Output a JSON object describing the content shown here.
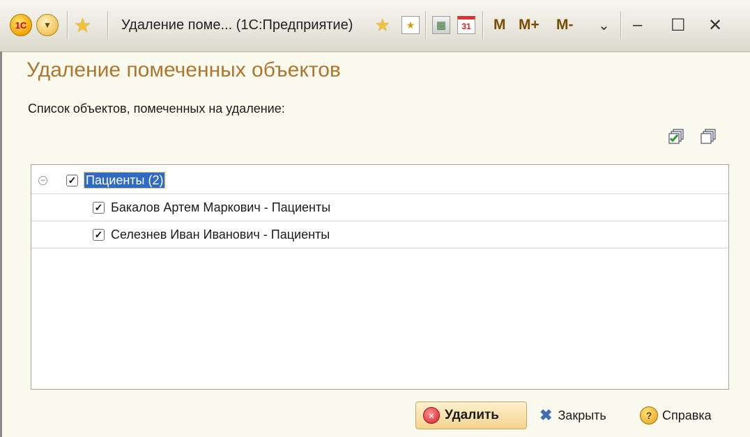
{
  "window": {
    "logo_text": "1C",
    "dropdown_glyph": "▼",
    "title": "Удаление поме...  (1С:Предприятие)",
    "memory_buttons": [
      "M",
      "M+",
      "M-"
    ],
    "overflow_glyph": "⌄",
    "minimize_glyph": "–",
    "maximize_glyph": "☐",
    "close_glyph": "✕",
    "calendar_day": "31"
  },
  "form": {
    "heading": "Удаление помеченных объектов",
    "list_label": "Список объектов, помеченных на удаление:"
  },
  "tree": {
    "group": {
      "label": "Пациенты (2)",
      "checked": true,
      "expanded": true
    },
    "items": [
      {
        "label": "Бакалов Артем Маркович - Пациенты",
        "checked": true
      },
      {
        "label": "Селезнев Иван Иванович - Пациенты",
        "checked": true
      }
    ]
  },
  "buttons": {
    "delete": "Удалить",
    "close": "Закрыть",
    "help": "Справка"
  },
  "icons": {
    "check_all": "check-all-icon",
    "uncheck_all": "uncheck-all-icon"
  },
  "colors": {
    "heading": "#b0752f",
    "background": "#fbfaee",
    "selection": "#316ac5"
  }
}
